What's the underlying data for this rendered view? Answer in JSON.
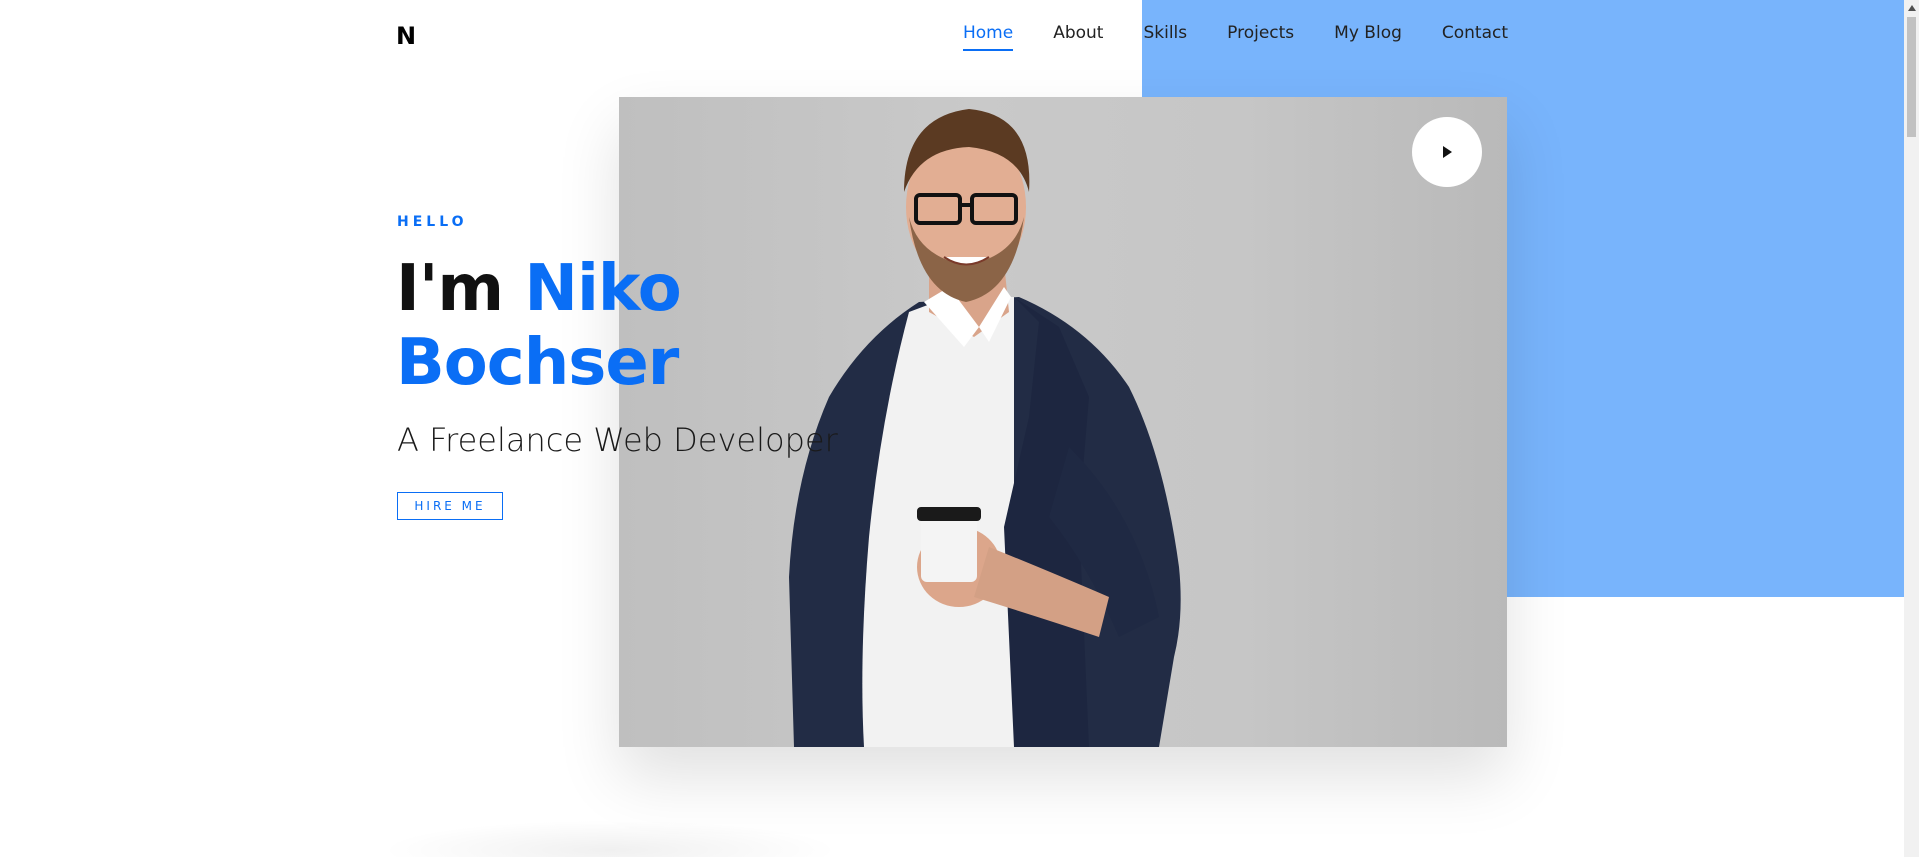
{
  "brand": {
    "logo": "N"
  },
  "nav": {
    "items": [
      {
        "label": "Home",
        "active": true
      },
      {
        "label": "About"
      },
      {
        "label": "Skills"
      },
      {
        "label": "Projects"
      },
      {
        "label": "My Blog"
      },
      {
        "label": "Contact"
      }
    ]
  },
  "hero": {
    "eyebrow": "HELLO",
    "greeting": "I'm",
    "first_name": "Niko",
    "last_name": "Bochser",
    "subtitle": "A Freelance Web Developer",
    "cta_label": "HIRE ME"
  },
  "colors": {
    "accent": "#0a6ef5",
    "panel": "#78b4fc"
  },
  "icons": {
    "play": "play-icon"
  }
}
